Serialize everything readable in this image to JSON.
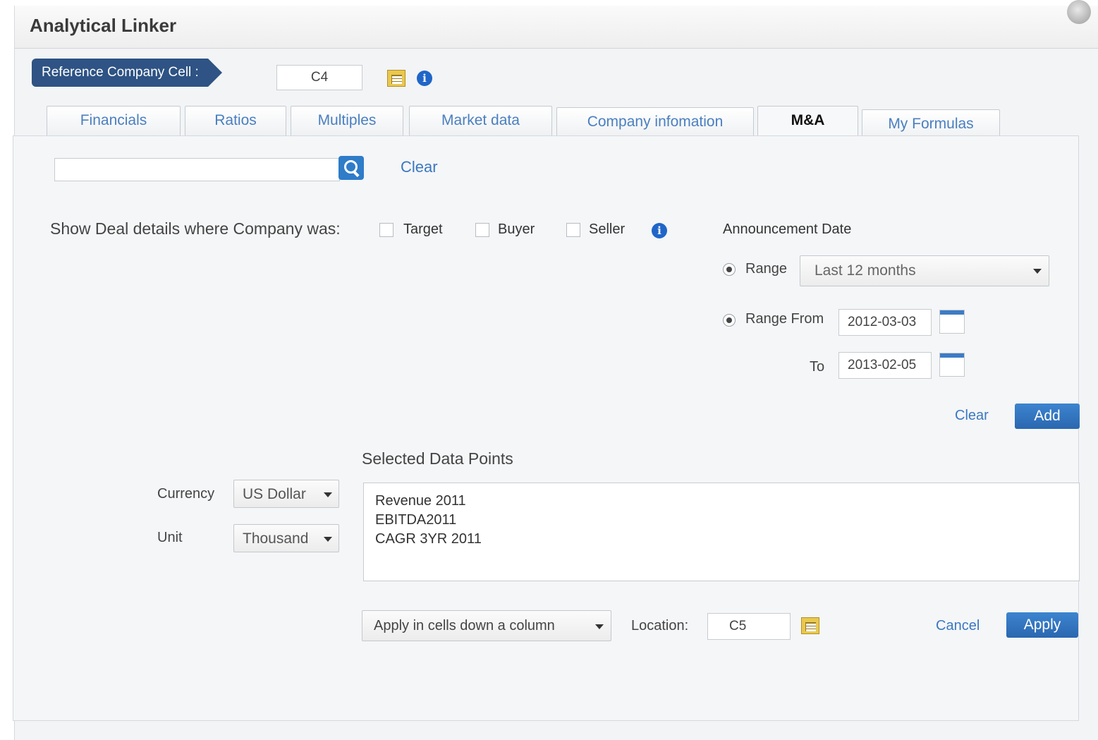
{
  "window": {
    "title": "Analytical Linker"
  },
  "reference": {
    "label": "Reference Company Cell :",
    "cell_value": "C4"
  },
  "tabs": [
    {
      "label": "Financials"
    },
    {
      "label": "Ratios"
    },
    {
      "label": "Multiples"
    },
    {
      "label": "Market data"
    },
    {
      "label": "Company infomation"
    },
    {
      "label": "M&A"
    },
    {
      "label": "My Formulas"
    }
  ],
  "active_tab": "M&A",
  "search": {
    "value": "",
    "clear_label": "Clear"
  },
  "deal_filter": {
    "prompt": "Show Deal details where Company was:",
    "options": [
      {
        "label": "Target",
        "checked": false
      },
      {
        "label": "Buyer",
        "checked": false
      },
      {
        "label": "Seller",
        "checked": false
      }
    ]
  },
  "announcement": {
    "heading": "Announcement Date",
    "range_label": "Range",
    "range_value": "Last 12 months",
    "range_from_label": "Range From",
    "from_date": "2012-03-03",
    "to_label": "To",
    "to_date": "2013-02-05"
  },
  "actions_top": {
    "clear_label": "Clear",
    "add_label": "Add"
  },
  "selected": {
    "heading": "Selected Data Points",
    "items": [
      "Revenue 2011",
      "EBITDA2011",
      "CAGR 3YR 2011"
    ]
  },
  "currency": {
    "label": "Currency",
    "value": "US Dollar"
  },
  "unit": {
    "label": "Unit",
    "value": "Thousand"
  },
  "apply_mode": {
    "value": "Apply in cells down a column"
  },
  "location": {
    "label": "Location:",
    "value": "C5"
  },
  "actions_bottom": {
    "cancel_label": "Cancel",
    "apply_label": "Apply"
  },
  "colors": {
    "accent": "#2e5384",
    "button": "#2f7cc9",
    "link": "#3c78c0"
  }
}
